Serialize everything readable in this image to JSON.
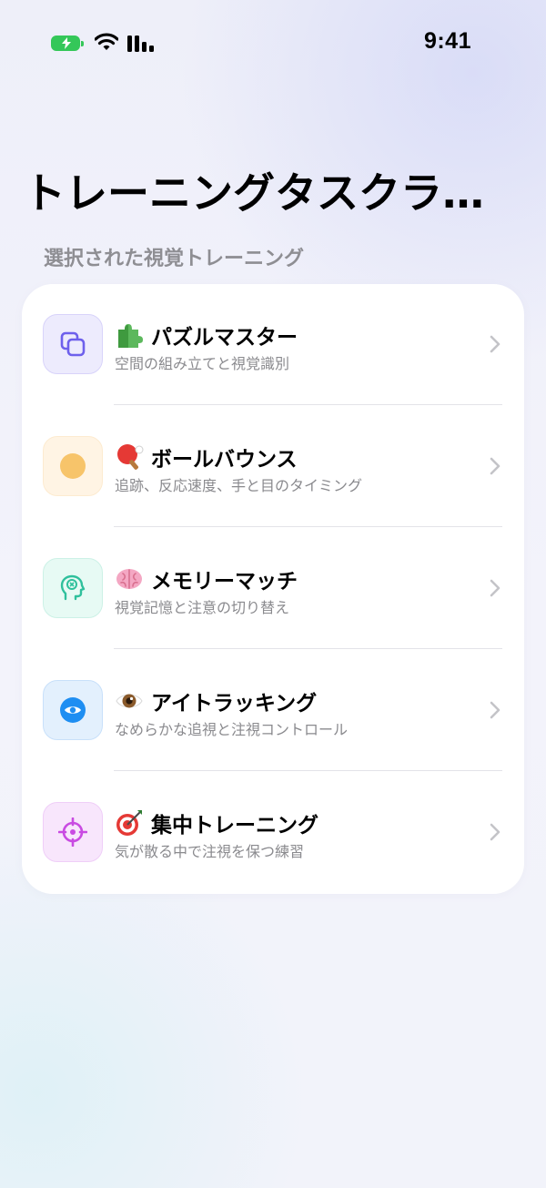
{
  "status_bar": {
    "time": "9:41"
  },
  "page": {
    "title": "トレーニングタスクラ…",
    "section_header": "選択された視覚トレーニング"
  },
  "tasks": [
    {
      "emoji": "puzzle-piece-emoji",
      "title": "パズルマスター",
      "subtitle": "空間の組み立てと視覚識別",
      "icon": "copy-squares-icon",
      "accent": "#7a6cf0"
    },
    {
      "emoji": "ping-pong-emoji",
      "title": "ボールバウンス",
      "subtitle": "追跡、反応速度、手と目のタイミング",
      "icon": "ball-icon",
      "accent": "#f7c46a"
    },
    {
      "emoji": "brain-emoji",
      "title": "メモリーマッチ",
      "subtitle": "視覚記憶と注意の切り替え",
      "icon": "head-brain-icon",
      "accent": "#34c6a5"
    },
    {
      "emoji": "eye-emoji",
      "title": "アイトラッキング",
      "subtitle": "なめらかな追視と注視コントロール",
      "icon": "eye-icon",
      "accent": "#1e8ef2"
    },
    {
      "emoji": "direct-hit-emoji",
      "title": "集中トレーニング",
      "subtitle": "気が散る中で注視を保つ練習",
      "icon": "crosshair-icon",
      "accent": "#c94be2"
    }
  ]
}
